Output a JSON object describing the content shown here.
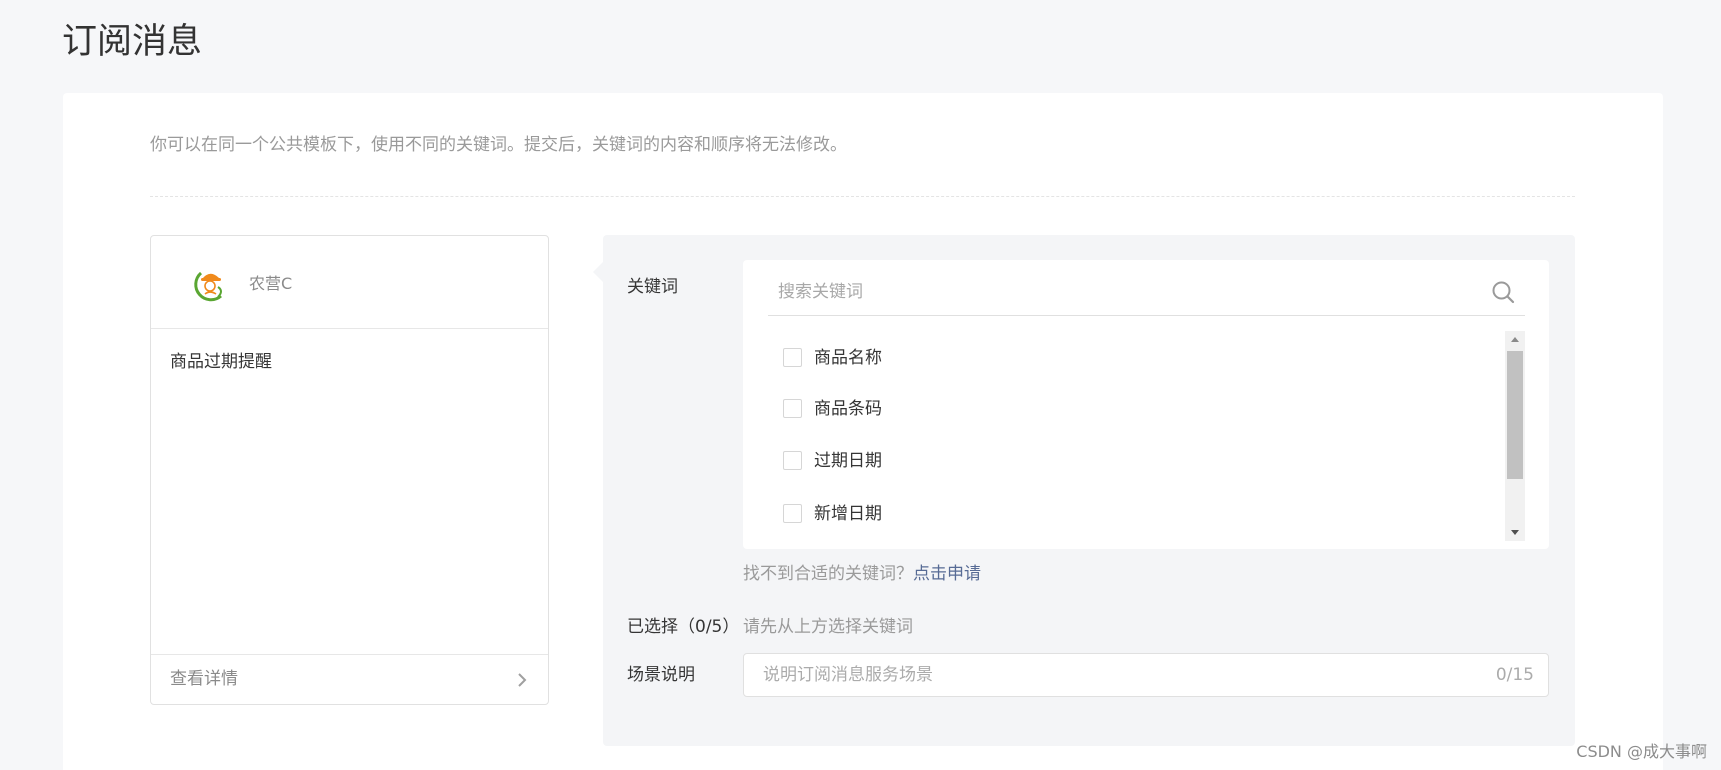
{
  "page": {
    "title": "订阅消息"
  },
  "intro": "你可以在同一个公共模板下，使用不同的关键词。提交后，关键词的内容和顺序将无法修改。",
  "preview": {
    "app_name": "农营C",
    "template_title": "商品过期提醒",
    "detail_link": "查看详情",
    "logo_icon": "app-logo-icon",
    "detail_icon": "chevron-right-icon"
  },
  "keywords": {
    "label": "关键词",
    "search_placeholder": "搜索关键词",
    "search_value": "",
    "search_icon": "search-icon",
    "items": [
      {
        "label": "商品名称",
        "checked": false
      },
      {
        "label": "商品条码",
        "checked": false
      },
      {
        "label": "过期日期",
        "checked": false
      },
      {
        "label": "新增日期",
        "checked": false
      }
    ],
    "help_text": "找不到合适的关键词？",
    "apply_link": "点击申请"
  },
  "selected": {
    "label": "已选择（0/5）",
    "hint": "请先从上方选择关键词"
  },
  "scene": {
    "label": "场景说明",
    "placeholder": "说明订阅消息服务场景",
    "value": "",
    "counter": "0/15"
  },
  "watermark": "CSDN @成大事啊",
  "colors": {
    "page_background": "#f6f7f9",
    "panel_background": "#f4f5f7",
    "link": "#576b95",
    "muted_text": "#9a9a9a",
    "primary_text": "#353535"
  }
}
